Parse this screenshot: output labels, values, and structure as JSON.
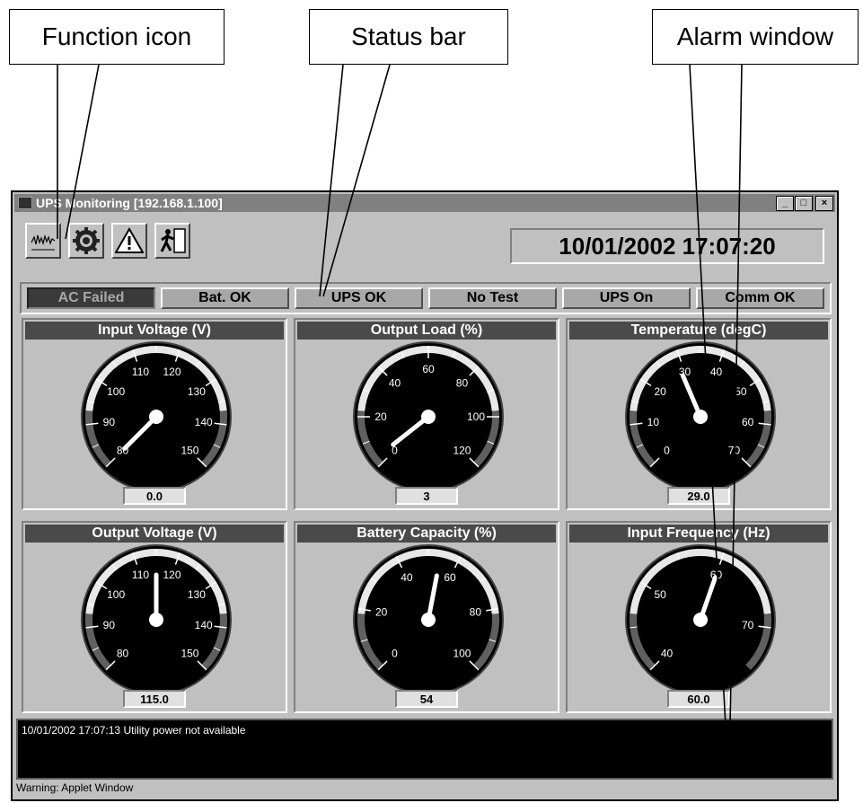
{
  "callouts": {
    "function_icon": "Function icon",
    "status_bar": "Status bar",
    "alarm_window": "Alarm window"
  },
  "window": {
    "title": "UPS Monitoring [192.168.1.100]",
    "controls": [
      "_",
      "□",
      "×"
    ]
  },
  "toolbar": {
    "icons": [
      "chart-icon",
      "gear-icon",
      "warning-icon",
      "exit-icon"
    ]
  },
  "datetime": "10/01/2002 17:07:20",
  "statuses": [
    {
      "label": "AC Failed",
      "state": "alarm"
    },
    {
      "label": "Bat. OK",
      "state": "ok"
    },
    {
      "label": "UPS OK",
      "state": "ok"
    },
    {
      "label": "No Test",
      "state": "ok"
    },
    {
      "label": "UPS On",
      "state": "ok"
    },
    {
      "label": "Comm OK",
      "state": "ok"
    }
  ],
  "gauges": [
    {
      "title": "Input Voltage (V)",
      "ticks": [
        "80",
        "90",
        "100",
        "110",
        "120",
        "130",
        "140",
        "150"
      ],
      "min": 80,
      "max": 150,
      "value": 75,
      "readout": "0.0"
    },
    {
      "title": "Output Load (%)",
      "ticks": [
        "0",
        "20",
        "40",
        "60",
        "80",
        "100",
        "120"
      ],
      "min": 0,
      "max": 120,
      "value": 3,
      "readout": "3"
    },
    {
      "title": "Temperature (degC)",
      "ticks": [
        "0",
        "10",
        "20",
        "30",
        "40",
        "50",
        "60",
        "70"
      ],
      "min": 0,
      "max": 70,
      "value": 29,
      "readout": "29.0"
    },
    {
      "title": "Output Voltage (V)",
      "ticks": [
        "80",
        "90",
        "100",
        "110",
        "120",
        "130",
        "140",
        "150"
      ],
      "min": 80,
      "max": 150,
      "value": 115,
      "readout": "115.0"
    },
    {
      "title": "Battery Capacity (%)",
      "ticks": [
        "0",
        "20",
        "40",
        "60",
        "80",
        "100"
      ],
      "min": 0,
      "max": 100,
      "value": 54,
      "readout": "54"
    },
    {
      "title": "Input Frequency (Hz)",
      "ticks": [
        "40",
        "50",
        "60",
        "70"
      ],
      "min": 40,
      "max": 75,
      "value": 60,
      "readout": "60.0"
    }
  ],
  "alarm_log": "10/01/2002 17:07:13  Utility power not available",
  "applet_warning": "Warning: Applet Window"
}
